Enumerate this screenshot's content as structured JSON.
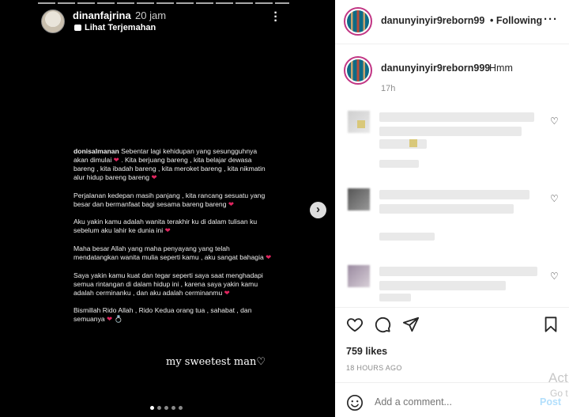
{
  "story": {
    "username": "dinanfajrina",
    "time": "20 jam",
    "translate": "Lihat Terjemahan",
    "post_username": "donisalmanan",
    "paragraphs": [
      "Sebentar lagi kehidupan yang sesungguhnya akan dimulai",
      ". Kita berjuang bareng , kita belajar dewasa bareng , kita ibadah bareng , kita meroket bareng , kita nikmatin alur hidup bareng bareng",
      "Perjalanan kedepan masih panjang , kita rancang sesuatu yang besar dan bermanfaat bagi sesama bareng bareng",
      "Aku yakin kamu adalah wanita terakhir ku di dalam tulisan ku sebelum aku lahir ke dunia ini",
      "Maha besar Allah yang maha penyayang yang telah mendatangkan wanita mulia seperti kamu , aku sangat bahagia",
      "Saya yakin kamu kuat dan tegar seperti saya saat menghadapi semua rintangan di dalam hidup ini , karena saya yakin kamu adalah cerminanku , dan aku adalah cerminanmu",
      "Bismillah Rido Allah , Rido Kedua orang tua , sahabat , dan semuanya"
    ],
    "signature": "my sweetest man♡"
  },
  "header": {
    "username": "danunyinyir9reborn99",
    "follow_status": "• Following",
    "more": "···"
  },
  "caption": {
    "username": "danunyinyir9reborn999",
    "text": "Hmm",
    "time": "17h"
  },
  "engagement": {
    "likes": "759 likes",
    "posted": "18 HOURS AGO"
  },
  "comment_box": {
    "placeholder": "Add a comment...",
    "post_label": "Post"
  },
  "overlay": {
    "activate_line1": "Act",
    "activate_line2": "Go t"
  },
  "icons": {
    "like": "heart-icon",
    "comment": "comment-bubble-icon",
    "share": "paper-plane-icon",
    "save": "bookmark-icon",
    "emoji": "smiley-icon",
    "next": "chevron-right-icon"
  },
  "colors": {
    "post_button": "#b2dffc",
    "avatar_ring": "#c13584",
    "heart": "#e0245e"
  }
}
